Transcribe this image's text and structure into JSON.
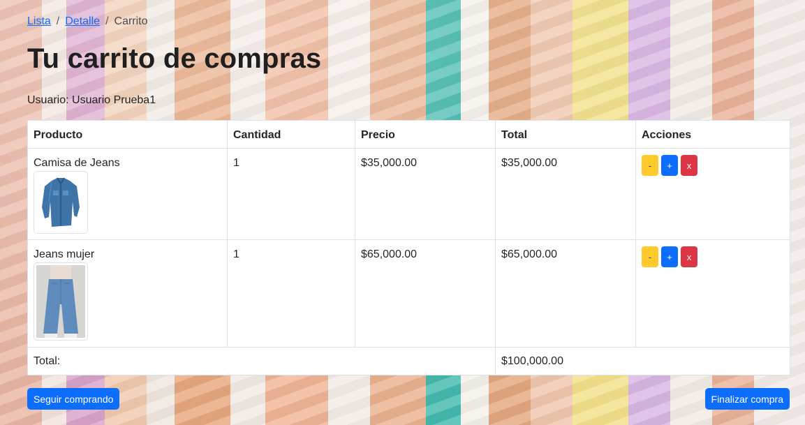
{
  "breadcrumb": {
    "items": [
      {
        "label": "Lista",
        "link": true
      },
      {
        "label": "Detalle",
        "link": true
      },
      {
        "label": "Carrito",
        "link": false
      }
    ],
    "separator": "/"
  },
  "page_title": "Tu carrito de compras",
  "user_line": "Usuario: Usuario Prueba1",
  "table": {
    "headers": [
      "Producto",
      "Cantidad",
      "Precio",
      "Total",
      "Acciones"
    ],
    "rows": [
      {
        "product": "Camisa de Jeans",
        "image_icon": "denim-shirt-image",
        "quantity": "1",
        "price": "$35,000.00",
        "total": "$35,000.00",
        "actions": {
          "decrease": "-",
          "increase": "+",
          "remove": "x"
        }
      },
      {
        "product": "Jeans mujer",
        "image_icon": "womens-jeans-image",
        "quantity": "1",
        "price": "$65,000.00",
        "total": "$65,000.00",
        "actions": {
          "decrease": "-",
          "increase": "+",
          "remove": "x"
        }
      }
    ],
    "footer": {
      "label": "Total:",
      "value": "$100,000.00"
    }
  },
  "buttons": {
    "continue": "Seguir comprando",
    "finish": "Finalizar compra"
  },
  "colors": {
    "primary": "#0d6efd",
    "warning": "#ffca2c",
    "danger": "#dc3545"
  }
}
